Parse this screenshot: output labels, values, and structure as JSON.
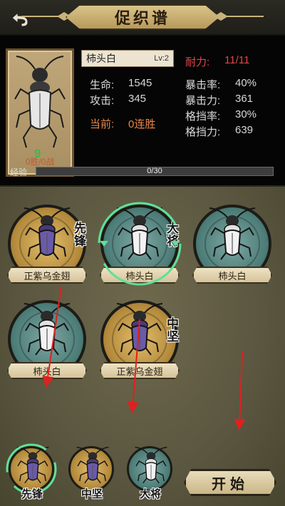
{
  "header": {
    "title": "促织谱",
    "back_icon": "back-arrow-icon"
  },
  "profile": {
    "name": "柿头白",
    "level": "Lv:2",
    "record": "0胜/0战",
    "level_mark": "9",
    "stats": {
      "hp_label": "生命:",
      "hp_value": "1545",
      "atk_label": "攻击:",
      "atk_value": "345",
      "streak_label": "当前:",
      "streak_value": "0连胜",
      "stamina_label": "耐力:",
      "stamina_value": "11/11",
      "crit_rate_label": "暴击率:",
      "crit_rate_value": "40%",
      "crit_dmg_label": "暴击力:",
      "crit_dmg_value": "361",
      "block_rate_label": "格挡率:",
      "block_rate_value": "30%",
      "block_power_label": "格挡力:",
      "block_power_value": "639"
    },
    "xp": {
      "label": "经验",
      "text": "0/30",
      "progress": 0.0
    }
  },
  "roster": [
    {
      "name": "正紫乌金翅",
      "style": "gold",
      "role": "先锋",
      "bug": "purple",
      "selected": false
    },
    {
      "name": "柿头白",
      "style": "teal",
      "role": "大将",
      "bug": "white",
      "selected": true
    },
    {
      "name": "柿头白",
      "style": "teal",
      "role": "",
      "bug": "white",
      "selected": false
    },
    {
      "name": "柿头白",
      "style": "teal",
      "role": "",
      "bug": "white",
      "selected": false
    },
    {
      "name": "正紫乌金翅",
      "style": "gold",
      "role": "中坚",
      "bug": "purple",
      "selected": false
    }
  ],
  "lineup": [
    {
      "label": "先锋",
      "style": "gold",
      "bug": "purple",
      "active": true
    },
    {
      "label": "中坚",
      "style": "gold",
      "bug": "purple",
      "active": false
    },
    {
      "label": "大将",
      "style": "teal",
      "bug": "white",
      "active": false
    }
  ],
  "start_button": "开始",
  "colors": {
    "stamina": "#e04848",
    "streak": "#e8864a",
    "select_ring": "#5ee09a",
    "arrow": "#e02020"
  }
}
